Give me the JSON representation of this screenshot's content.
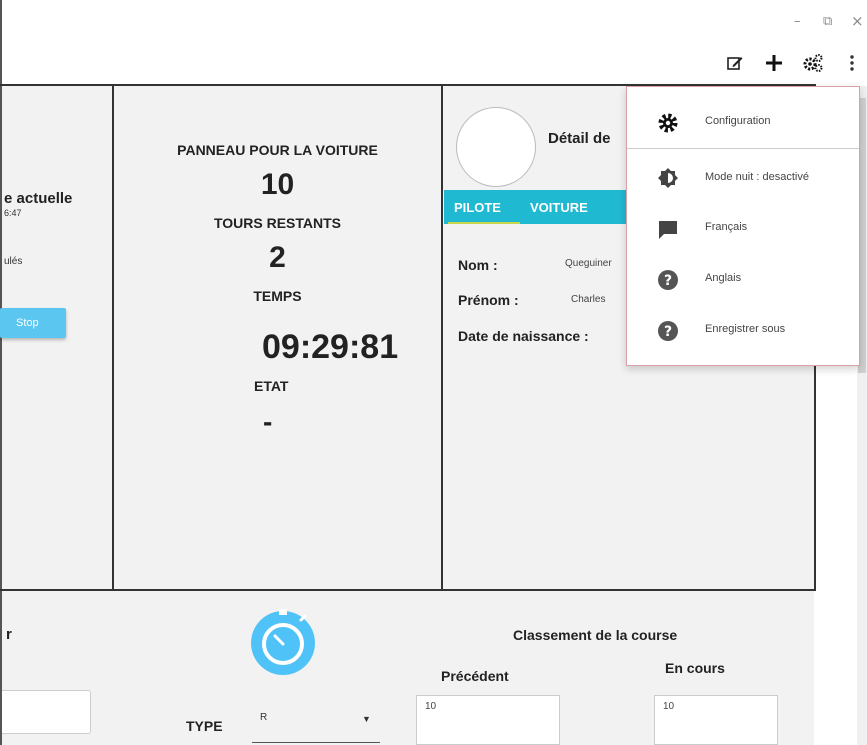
{
  "window": {
    "minimize": "–",
    "maximize": "⧉",
    "close": "×"
  },
  "toolbar": {
    "icons": [
      "edit-icon",
      "plus-icon",
      "settings-icon",
      "more-icon"
    ]
  },
  "left_panel": {
    "title_fragment": "e actuelle",
    "time_fragment": "6:47",
    "status_fragment": "ulés",
    "stop_label": "Stop"
  },
  "board": {
    "title": "PANNEAU POUR LA VOITURE",
    "laps_value": "10",
    "laps_label": "TOURS RESTANTS",
    "time_count": "2",
    "time_label": "TEMPS",
    "time_value": "09:29:81",
    "state_label": "ETAT",
    "state_value": "-"
  },
  "detail": {
    "title_fragment": "Détail de",
    "tabs": [
      "PILOTE",
      "VOITURE"
    ],
    "fields": [
      {
        "label": "Nom :",
        "value": "Queguiner"
      },
      {
        "label": "Prénom :",
        "value": "Charles"
      },
      {
        "label": "Date de naissance :",
        "value": ""
      }
    ]
  },
  "menu": {
    "items": [
      {
        "icon": "gear-icon",
        "label": "Configuration"
      },
      {
        "icon": "brightness-icon",
        "label": "Mode nuit : desactivé"
      },
      {
        "icon": "comment-icon",
        "label": "Français"
      },
      {
        "icon": "help-icon",
        "label": "Anglais"
      },
      {
        "icon": "help-icon",
        "label": "Enregistrer sous"
      }
    ]
  },
  "bottom": {
    "left_fragment": "r",
    "ranking_title": "Classement de la course",
    "previous_label": "Précédent",
    "current_label": "En cours",
    "previous_value": "10",
    "current_value": "10",
    "type_label": "TYPE",
    "type_value": "R"
  },
  "colors": {
    "accent": "#20b9d2",
    "button": "#5bc6f0",
    "stopwatch": "#4fc3f7",
    "panel_bg": "#f2f2f2"
  }
}
